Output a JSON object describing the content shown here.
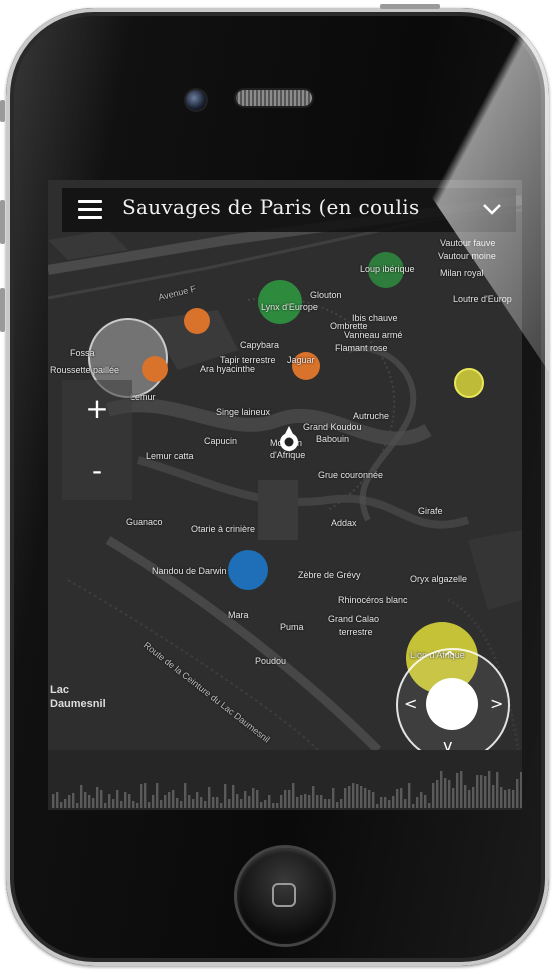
{
  "app": {
    "title": "Sauvages de Paris (en coulis",
    "icons": {
      "menu": "hamburger-icon",
      "dropdown": "chevron-down-icon",
      "location": "location-pin-icon"
    }
  },
  "zoom": {
    "in_label": "+",
    "out_label": "-"
  },
  "map": {
    "streets": {
      "avenue": "Avenue F",
      "route": "Route de la Ceinture du Lac Daumesnil",
      "lac": "Lac",
      "daumesnil": "Daumesnil"
    },
    "labels": [
      "Vautour fauve",
      "Vautour moine",
      "Milan royal",
      "Loutre d'Europ",
      "Loup ibérique",
      "Glouton",
      "Lynx d'Europe",
      "Ibis chauve",
      "Ombrette",
      "Vanneau armé",
      "Flamant rose",
      "Fossa",
      "Roussette paillée",
      "Capybara",
      "Tapir terrestre",
      "Jaguar",
      "Ara hyacinthe",
      "Lemur",
      "Singe laineux",
      "Autruche",
      "Grand Koudou",
      "Capucin",
      "Mouflon",
      "Lemur catta",
      "Grue couronnée",
      "Girafe",
      "Guanaco",
      "Otarie à crinière",
      "Addax",
      "Nandou de Darwin",
      "Zèbre de Grévy",
      "Oryx algazelle",
      "Rhinocéros blanc",
      "Mara",
      "Puma",
      "Grand Calao",
      "terrestre",
      "Poudou",
      "Lion d'Afrique",
      "Babouin",
      "d'Afrique"
    ]
  },
  "joystick": {
    "up": "^",
    "down": "v",
    "left": "<",
    "right": ">"
  },
  "colors": {
    "green": "#2e8b3e",
    "orange": "#d9722a",
    "yellow": "#d6d33a",
    "blue": "#1f6fb8",
    "map_bg": "#2e2e2e"
  },
  "device": {
    "icons": {
      "home": "home-button-icon",
      "camera": "camera-icon",
      "speaker": "speaker-icon"
    }
  }
}
